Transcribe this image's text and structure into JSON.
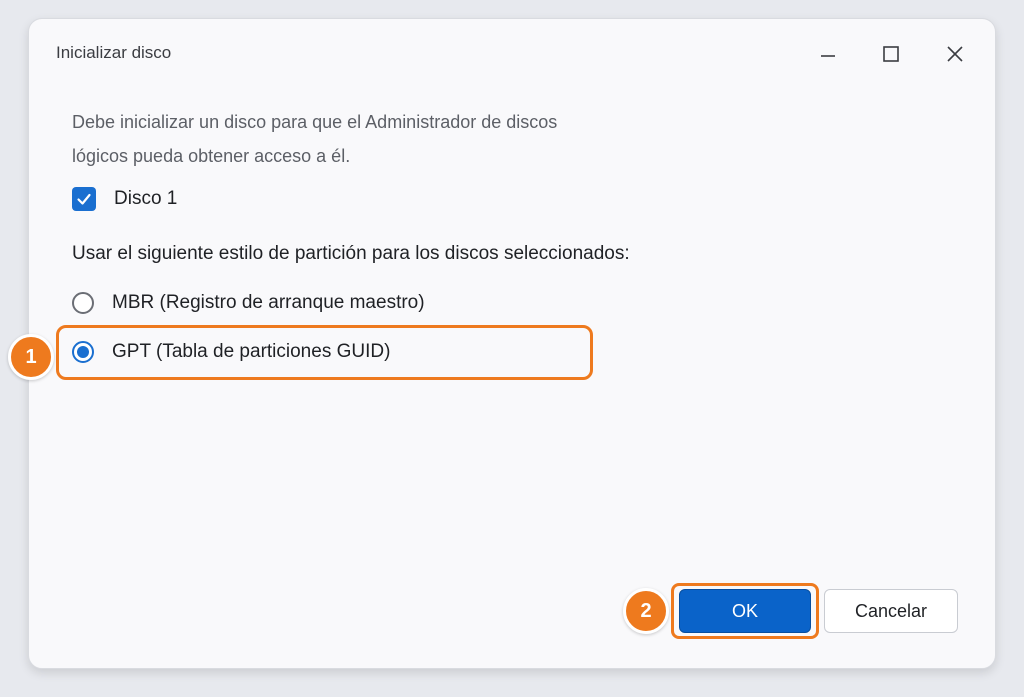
{
  "window": {
    "title": "Inicializar disco",
    "controls": {
      "minimize": "minimize-icon",
      "maximize": "maximize-icon",
      "close": "close-icon"
    }
  },
  "description": {
    "line1": "Debe inicializar un disco para que el Administrador de discos",
    "line2": "lógicos pueda obtener acceso a él."
  },
  "disks": [
    {
      "label": "Disco 1",
      "checked": true
    }
  ],
  "partition_style": {
    "heading": "Usar el siguiente estilo de partición para los discos seleccionados:",
    "options": [
      {
        "label": "MBR (Registro de arranque maestro)",
        "selected": false
      },
      {
        "label": "GPT (Tabla de particiones GUID)",
        "selected": true
      }
    ]
  },
  "buttons": {
    "ok": "OK",
    "cancel": "Cancelar"
  },
  "annotations": {
    "step1": "1",
    "step2": "2"
  },
  "colors": {
    "accent": "#0a63c9",
    "highlight": "#ee7a1e"
  }
}
